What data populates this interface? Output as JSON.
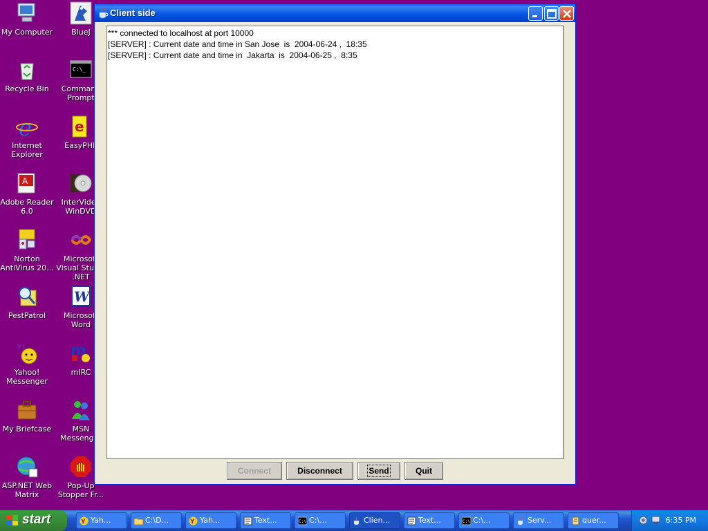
{
  "desktop": {
    "icons": [
      {
        "label": "My Computer",
        "icon": "my-computer-icon"
      },
      {
        "label": "BlueJ",
        "icon": "bluej-icon"
      },
      {
        "label": "Recycle Bin",
        "icon": "recycle-bin-icon"
      },
      {
        "label": "Command Prompt",
        "icon": "command-prompt-icon"
      },
      {
        "label": "Internet Explorer",
        "icon": "internet-explorer-icon"
      },
      {
        "label": "EasyPHP",
        "icon": "easyphp-icon"
      },
      {
        "label": "Adobe Reader 6.0",
        "icon": "adobe-reader-icon"
      },
      {
        "label": "InterVideo WinDVD",
        "icon": "windvd-icon"
      },
      {
        "label": "Norton AntiVirus 20...",
        "icon": "norton-antivirus-icon"
      },
      {
        "label": "Microsoft Visual Studio .NET",
        "icon": "visual-studio-icon"
      },
      {
        "label": "PestPatrol",
        "icon": "pestpatrol-icon"
      },
      {
        "label": "Microsoft Word",
        "icon": "microsoft-word-icon"
      },
      {
        "label": "Yahoo! Messenger",
        "icon": "yahoo-messenger-icon"
      },
      {
        "label": "mIRC",
        "icon": "mirc-icon"
      },
      {
        "label": "My Briefcase",
        "icon": "briefcase-icon"
      },
      {
        "label": "MSN Messenger",
        "icon": "msn-messenger-icon"
      },
      {
        "label": "ASP.NET Web Matrix",
        "icon": "web-matrix-icon"
      },
      {
        "label": "Pop-Up Stopper Fr...",
        "icon": "popup-stopper-icon"
      }
    ]
  },
  "window": {
    "title": "Client side",
    "icon": "java-cup-icon",
    "log_lines": [
      "*** connected to localhost at port 10000",
      "[SERVER] : Current date and time in San Jose  is  2004-06-24 ,  18:35",
      "[SERVER] : Current date and time in  Jakarta  is  2004-06-25 ,  8:35"
    ],
    "buttons": {
      "connect": "Connect",
      "disconnect": "Disconnect",
      "send": "Send",
      "quit": "Quit"
    }
  },
  "taskbar": {
    "start_label": "start",
    "tasks": [
      {
        "label": "Yah...",
        "icon": "yahoo-icon"
      },
      {
        "label": "C:\\D...",
        "icon": "folder-icon"
      },
      {
        "label": "Yah...",
        "icon": "yahoo-icon"
      },
      {
        "label": "Text...",
        "icon": "textpad-icon"
      },
      {
        "label": "C:\\...",
        "icon": "cmd-icon"
      },
      {
        "label": "Clien...",
        "icon": "java-icon"
      },
      {
        "label": "Text...",
        "icon": "textpad-icon"
      },
      {
        "label": "C:\\...",
        "icon": "cmd-icon"
      },
      {
        "label": "Serv...",
        "icon": "java-icon"
      },
      {
        "label": "quer...",
        "icon": "query-icon"
      }
    ],
    "clock": "6:35 PM"
  },
  "colors": {
    "desktop": "#800080",
    "titlebar": "#0053e1",
    "taskbar": "#2157d7",
    "start": "#3a8c3a"
  }
}
